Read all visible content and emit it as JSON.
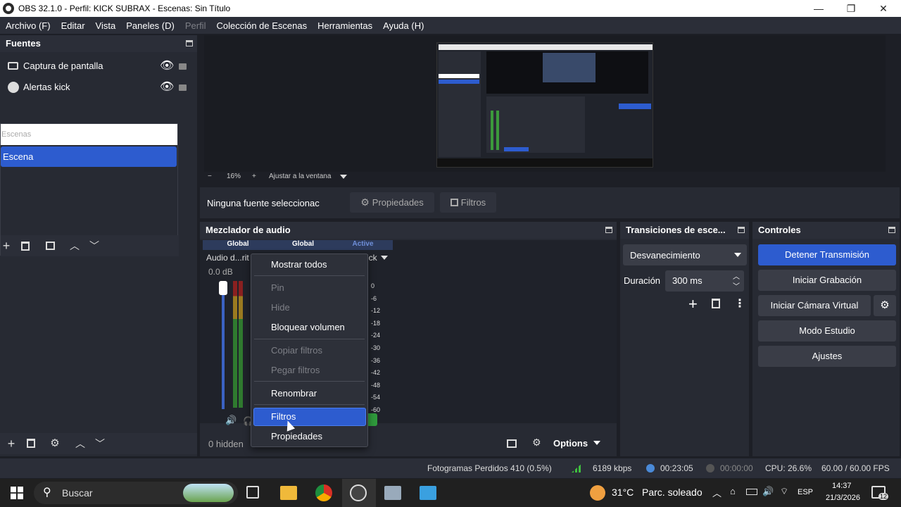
{
  "titlebar": {
    "title": "OBS 32.1.0 - Perfil: KICK SUBRAX - Escenas: Sin Título",
    "minimize": "—",
    "maximize": "❐",
    "close": "✕"
  },
  "menu": {
    "items": [
      {
        "label": "Archivo (F)"
      },
      {
        "label": "Editar"
      },
      {
        "label": "Vista"
      },
      {
        "label": "Paneles (D)"
      },
      {
        "label": "Perfil",
        "disabled": true
      },
      {
        "label": "Colección de Escenas"
      },
      {
        "label": "Herramientas"
      },
      {
        "label": "Ayuda (H)"
      }
    ]
  },
  "sources": {
    "title": "Fuentes",
    "items": [
      "Captura de pantalla",
      "Alertas kick"
    ]
  },
  "scenes": {
    "header": "Escenas",
    "items": [
      "Escena"
    ]
  },
  "preview": {
    "zoom_minus": "−",
    "zoom": "16%",
    "zoom_plus": "+",
    "fit": "Ajustar a la ventana"
  },
  "context_bar": {
    "no_source": "Ninguna fuente seleccionac",
    "properties": "Propiedades",
    "filters": "Filtros"
  },
  "mixer": {
    "title": "Mezclador de audio",
    "tabs": [
      "Global",
      "Global",
      "Active"
    ],
    "channel_name": "Audio d...rit",
    "channel_right": "ick",
    "db": "0.0 dB",
    "scale": [
      "0",
      "-6",
      "-12",
      "-18",
      "-24",
      "-30",
      "-36",
      "-42",
      "-48",
      "-54",
      "-60"
    ],
    "hidden": "0 hidden",
    "options": "Options"
  },
  "context_menu": {
    "items": [
      "Mostrar todos",
      "Pin",
      "Hide",
      "Bloquear volumen",
      "Copiar filtros",
      "Pegar filtros",
      "Renombrar",
      "Filtros",
      "Propiedades"
    ]
  },
  "transitions": {
    "title": "Transiciones de esce...",
    "selected": "Desvanecimiento",
    "duration_label": "Duración",
    "duration_value": "300 ms"
  },
  "controls": {
    "title": "Controles",
    "stop_stream": "Detener Transmisión",
    "start_record": "Iniciar Grabación",
    "start_vcam": "Iniciar Cámara Virtual",
    "studio": "Modo Estudio",
    "settings": "Ajustes"
  },
  "statusbar": {
    "dropped": "Fotogramas Perdidos 410 (0.5%)",
    "kbps": "6189 kbps",
    "stream_time": "00:23:05",
    "rec_time": "00:00:00",
    "cpu": "CPU: 26.6%",
    "fps": "60.00 / 60.00 FPS"
  },
  "taskbar": {
    "search": "Buscar",
    "weather_temp": "31°C",
    "weather_desc": "Parc. soleado",
    "lang": "ESP",
    "time": "14:37",
    "date": "21/3/2026",
    "notif": "12"
  },
  "colors": {
    "accent": "#2d5ccf",
    "panel": "#272a33",
    "bg": "#1d1f26"
  }
}
